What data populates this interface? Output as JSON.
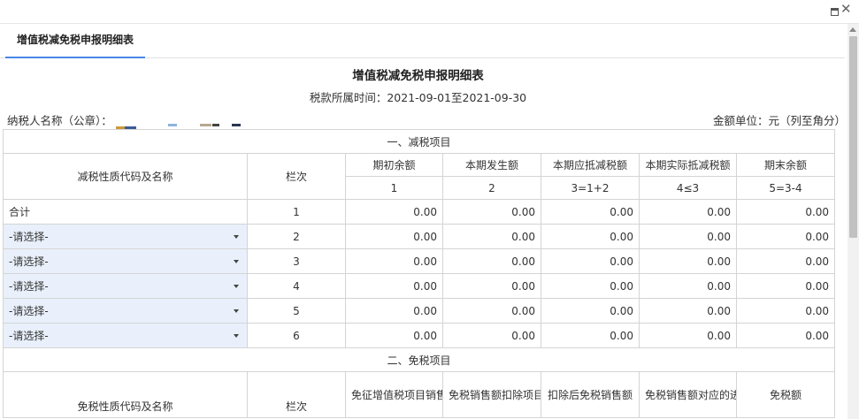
{
  "window": {
    "maximize_icon": "maximize-icon",
    "close_icon": "close-icon",
    "close_glyph": "✕"
  },
  "tabs": [
    {
      "label": "增值税减免税申报明细表",
      "active": true
    }
  ],
  "form": {
    "title": "增值税减免税申报明细表",
    "period": "税款所属时间：2021-09-01至2021-09-30",
    "taxpayer_label": "纳税人名称（公章）：",
    "unit": "金额单位：元（列至角分）"
  },
  "reduction": {
    "section_title": "一、减税项目",
    "code_header": "减税性质代码及名称",
    "line_header": "栏次",
    "columns": [
      "期初余额",
      "本期发生额",
      "本期应抵减税额",
      "本期实际抵减税额",
      "期末余额"
    ],
    "column_nums": [
      "1",
      "2",
      "3=1+2",
      "4≤3",
      "5=3-4"
    ],
    "total_label": "合计",
    "rows": [
      {
        "code": "合计",
        "line": "1",
        "values": [
          "0.00",
          "0.00",
          "0.00",
          "0.00",
          "0.00"
        ]
      },
      {
        "code": "-请选择-",
        "line": "2",
        "values": [
          "0.00",
          "0.00",
          "0.00",
          "0.00",
          "0.00"
        ]
      },
      {
        "code": "-请选择-",
        "line": "3",
        "values": [
          "0.00",
          "0.00",
          "0.00",
          "0.00",
          "0.00"
        ]
      },
      {
        "code": "-请选择-",
        "line": "4",
        "values": [
          "0.00",
          "0.00",
          "0.00",
          "0.00",
          "0.00"
        ]
      },
      {
        "code": "-请选择-",
        "line": "5",
        "values": [
          "0.00",
          "0.00",
          "0.00",
          "0.00",
          "0.00"
        ]
      },
      {
        "code": "-请选择-",
        "line": "6",
        "values": [
          "0.00",
          "0.00",
          "0.00",
          "0.00",
          "0.00"
        ]
      }
    ]
  },
  "exemption": {
    "section_title": "二、免税项目",
    "code_header": "免税性质代码及名称",
    "line_header": "栏次",
    "columns": [
      "免征增值税项目销售额",
      "免税销售额扣除项目本期实际扣除金额",
      "扣除后免税销售额",
      "免税销售额对应的进项税额",
      "免税额"
    ]
  }
}
